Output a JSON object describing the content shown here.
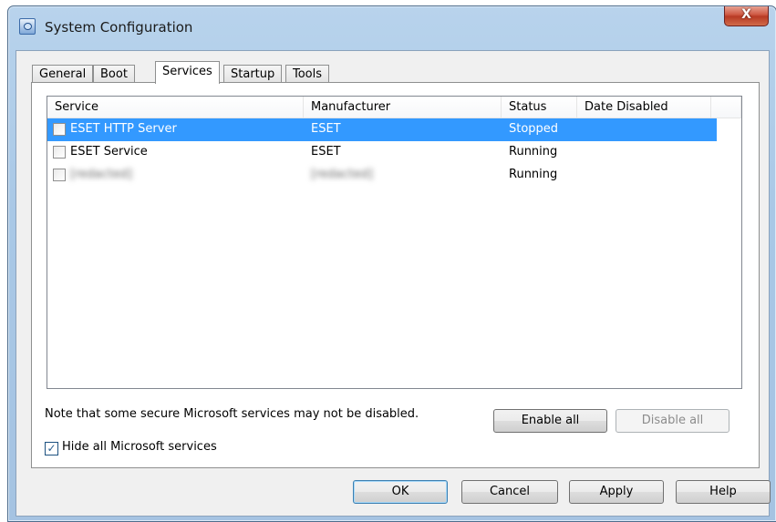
{
  "window": {
    "title": "System Configuration",
    "close_glyph": "X"
  },
  "tabs": [
    "General",
    "Boot",
    "Services",
    "Startup",
    "Tools"
  ],
  "active_tab": "Services",
  "columns": [
    "Service",
    "Manufacturer",
    "Status",
    "Date Disabled"
  ],
  "services": [
    {
      "name": "ESET HTTP Server",
      "manufacturer": "ESET",
      "status": "Stopped",
      "date_disabled": "",
      "checked": false,
      "selected": true
    },
    {
      "name": "ESET Service",
      "manufacturer": "ESET",
      "status": "Running",
      "date_disabled": "",
      "checked": false,
      "selected": false
    },
    {
      "name": "[redacted]",
      "manufacturer": "[redacted]",
      "status": "Running",
      "date_disabled": "",
      "checked": false,
      "selected": false
    }
  ],
  "note": "Note that some secure Microsoft services may not be disabled.",
  "enable_all_label": "Enable all",
  "disable_all_label": "Disable all",
  "hide_ms_label": "Hide all Microsoft services",
  "hide_ms_checked": true,
  "buttons": {
    "ok": "OK",
    "cancel": "Cancel",
    "apply": "Apply",
    "help": "Help"
  },
  "icons": {
    "app": "system-configuration-icon",
    "close": "close-icon",
    "checkmark": "✓"
  },
  "colors": {
    "selection": "#3399ff",
    "title_gradient": "#b8d3ec",
    "close_red": "#cf5a45"
  }
}
